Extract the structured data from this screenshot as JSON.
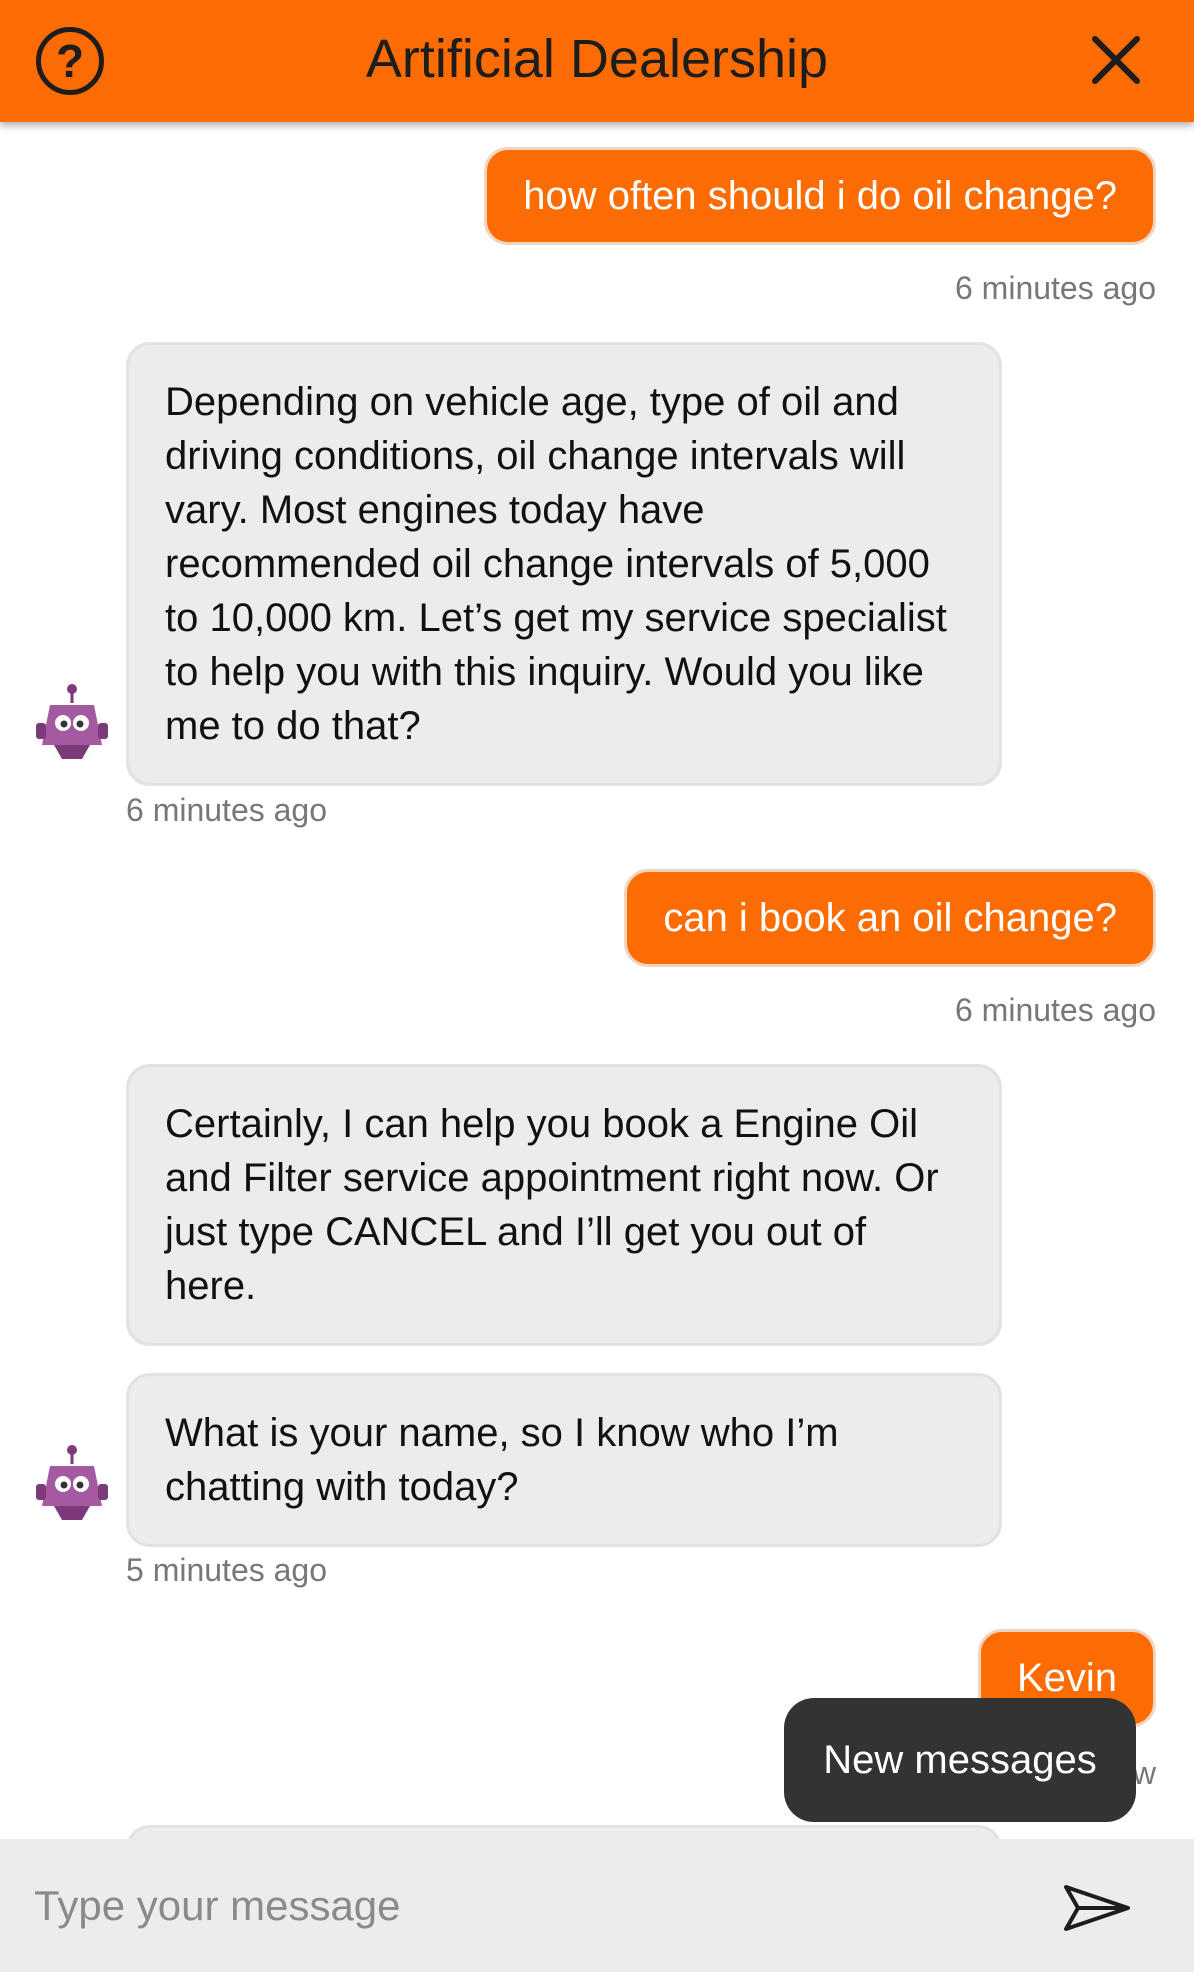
{
  "header": {
    "title": "Artificial Dealership",
    "help_icon": "question-circle-icon",
    "close_icon": "close-x-icon"
  },
  "colors": {
    "brand": "#fd6b03",
    "bot_bubble": "#ececec",
    "toast": "#333333"
  },
  "messages": [
    {
      "sender": "user",
      "text": "how often should i do oil change?",
      "time": "6 minutes ago"
    },
    {
      "sender": "bot",
      "text": "Depending on vehicle age, type of oil and driving conditions, oil change intervals will vary. Most engines today have recommended oil change intervals of 5,000 to 10,000 km. Let’s get my service specialist to help you with this inquiry. Would you like me to do that?",
      "time": "6 minutes ago"
    },
    {
      "sender": "user",
      "text": "can i book an oil change?",
      "time": "6 minutes ago"
    },
    {
      "sender": "bot",
      "text": "Certainly, I can help you book a Engine Oil and Filter service appointment right now. Or just type CANCEL and I’ll get you out of here.",
      "time": ""
    },
    {
      "sender": "bot",
      "text": "What is your name, so I know who I’m chatting with today?",
      "time": "5 minutes ago"
    },
    {
      "sender": "user",
      "text": "Kevin",
      "time": "Just now"
    }
  ],
  "toast": {
    "label": "New messages"
  },
  "composer": {
    "placeholder": "Type your message",
    "value": "",
    "send_icon": "send-arrow-icon"
  }
}
